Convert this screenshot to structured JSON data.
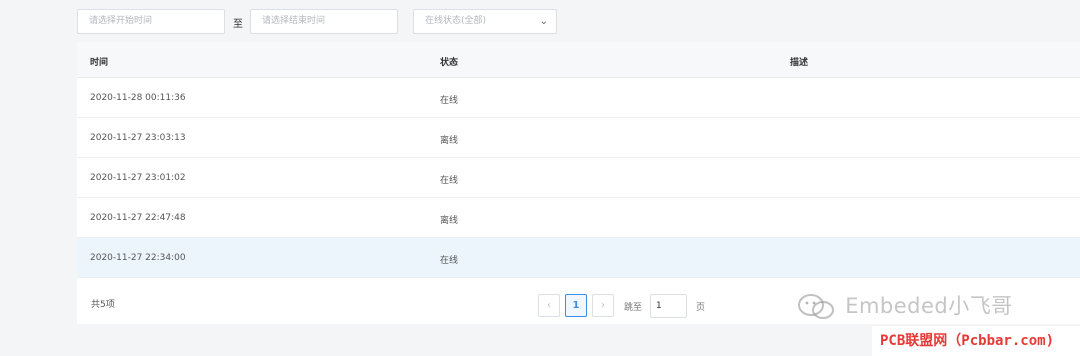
{
  "filters": {
    "start_placeholder": "请选择开始时间",
    "range_separator": "至",
    "end_placeholder": "请选择结束时间",
    "status_placeholder": "在线状态(全部)"
  },
  "table": {
    "headers": {
      "time": "时间",
      "status": "状态",
      "description": "描述"
    },
    "rows": [
      {
        "time": "2020-11-28 00:11:36",
        "status": "在线",
        "description": ""
      },
      {
        "time": "2020-11-27 23:03:13",
        "status": "离线",
        "description": ""
      },
      {
        "time": "2020-11-27 23:01:02",
        "status": "在线",
        "description": ""
      },
      {
        "time": "2020-11-27 22:47:48",
        "status": "离线",
        "description": ""
      },
      {
        "time": "2020-11-27 22:34:00",
        "status": "在线",
        "description": ""
      }
    ]
  },
  "pagination": {
    "total": "共5项",
    "current_page": "1",
    "jump_label": "跳至",
    "jump_value": "1",
    "jump_unit": "页"
  },
  "watermark": {
    "text": "Embeded小飞哥"
  },
  "source_tag": {
    "text": "PCB联盟网（Pcbbar.com)"
  }
}
